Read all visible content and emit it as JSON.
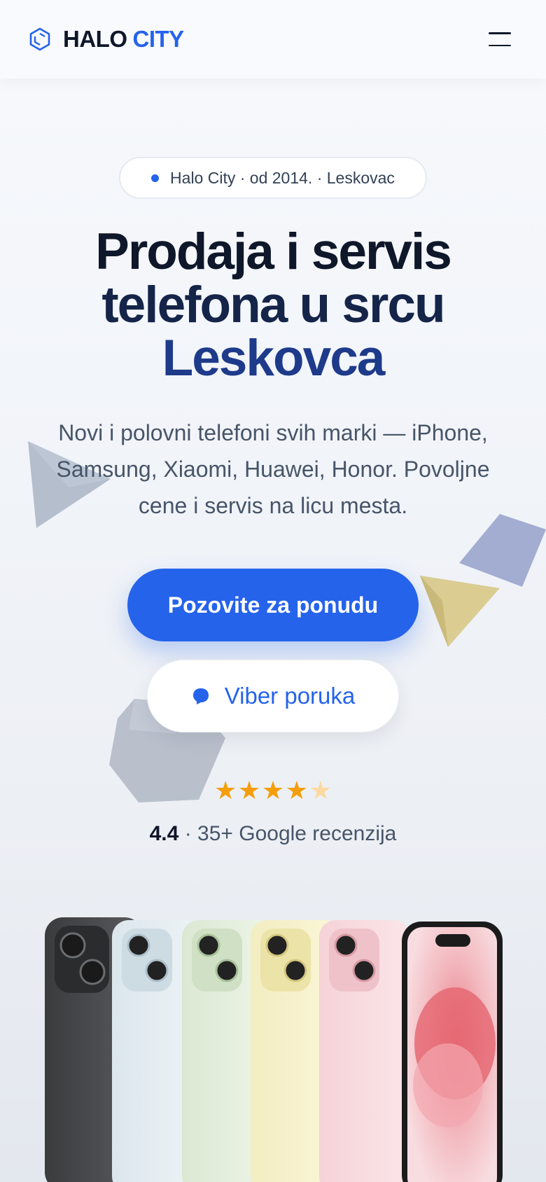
{
  "header": {
    "logo_icon": "hexagon-logo-icon",
    "brand_first": "HALO",
    "brand_second": "CITY",
    "menu_icon": "hamburger-menu-icon"
  },
  "hero": {
    "badge": "Halo City · od 2014. · Leskovac",
    "title_line1": "Prodaja i servis",
    "title_line2": "telefona u srcu",
    "title_line3": "Leskovca",
    "subtitle": "Novi i polovni telefoni svih marki — iPhone, Samsung, Xiaomi, Huawei, Honor. Povoljne cene i servis na licu mesta."
  },
  "actions": {
    "call_label": "Pozovite za ponudu",
    "viber_label": "Viber poruka",
    "viber_icon": "chat-bubble-icon"
  },
  "rating": {
    "stars": 4.4,
    "score": "4.4",
    "text": "· 35+ Google recenzija"
  },
  "product_image": {
    "colors": [
      "black",
      "blue",
      "green",
      "yellow",
      "pink"
    ]
  },
  "colors": {
    "accent": "#2563eb",
    "heading": "#0f172a",
    "heading_accent": "#1e3a8a",
    "star": "#f59e0b"
  }
}
